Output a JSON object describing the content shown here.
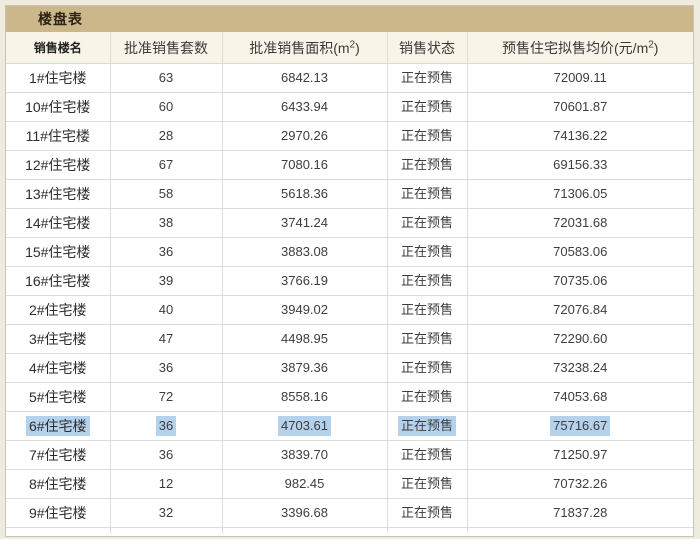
{
  "panel": {
    "title": "楼盘表"
  },
  "table": {
    "columns": [
      {
        "pre": "销售楼名",
        "sup": "",
        "post": ""
      },
      {
        "pre": "批准销售套数",
        "sup": "",
        "post": ""
      },
      {
        "pre": "批准销售面积(m",
        "sup": "2",
        "post": ")"
      },
      {
        "pre": "销售状态",
        "sup": "",
        "post": ""
      },
      {
        "pre": "预售住宅拟售均价(元/m",
        "sup": "2",
        "post": ")"
      }
    ],
    "rows": [
      {
        "name": "1#住宅楼",
        "units": "63",
        "area": "6842.13",
        "status": "正在预售",
        "price": "72009.11",
        "selected": false
      },
      {
        "name": "10#住宅楼",
        "units": "60",
        "area": "6433.94",
        "status": "正在预售",
        "price": "70601.87",
        "selected": false
      },
      {
        "name": "11#住宅楼",
        "units": "28",
        "area": "2970.26",
        "status": "正在预售",
        "price": "74136.22",
        "selected": false
      },
      {
        "name": "12#住宅楼",
        "units": "67",
        "area": "7080.16",
        "status": "正在预售",
        "price": "69156.33",
        "selected": false
      },
      {
        "name": "13#住宅楼",
        "units": "58",
        "area": "5618.36",
        "status": "正在预售",
        "price": "71306.05",
        "selected": false
      },
      {
        "name": "14#住宅楼",
        "units": "38",
        "area": "3741.24",
        "status": "正在预售",
        "price": "72031.68",
        "selected": false
      },
      {
        "name": "15#住宅楼",
        "units": "36",
        "area": "3883.08",
        "status": "正在预售",
        "price": "70583.06",
        "selected": false
      },
      {
        "name": "16#住宅楼",
        "units": "39",
        "area": "3766.19",
        "status": "正在预售",
        "price": "70735.06",
        "selected": false
      },
      {
        "name": "2#住宅楼",
        "units": "40",
        "area": "3949.02",
        "status": "正在预售",
        "price": "72076.84",
        "selected": false
      },
      {
        "name": "3#住宅楼",
        "units": "47",
        "area": "4498.95",
        "status": "正在预售",
        "price": "72290.60",
        "selected": false
      },
      {
        "name": "4#住宅楼",
        "units": "36",
        "area": "3879.36",
        "status": "正在预售",
        "price": "73238.24",
        "selected": false
      },
      {
        "name": "5#住宅楼",
        "units": "72",
        "area": "8558.16",
        "status": "正在预售",
        "price": "74053.68",
        "selected": false
      },
      {
        "name": "6#住宅楼",
        "units": "36",
        "area": "4703.61",
        "status": "正在预售",
        "price": "75716.67",
        "selected": true
      },
      {
        "name": "7#住宅楼",
        "units": "36",
        "area": "3839.70",
        "status": "正在预售",
        "price": "71250.97",
        "selected": false
      },
      {
        "name": "8#住宅楼",
        "units": "12",
        "area": "982.45",
        "status": "正在预售",
        "price": "70732.26",
        "selected": false
      },
      {
        "name": "9#住宅楼",
        "units": "32",
        "area": "3396.68",
        "status": "正在预售",
        "price": "71837.28",
        "selected": false
      }
    ]
  },
  "colors": {
    "title_bar": "#cbb789",
    "header_bg": "#f8f4e8",
    "selection_highlight": "#b5d2ed",
    "page_bg": "#f0ebdf"
  }
}
